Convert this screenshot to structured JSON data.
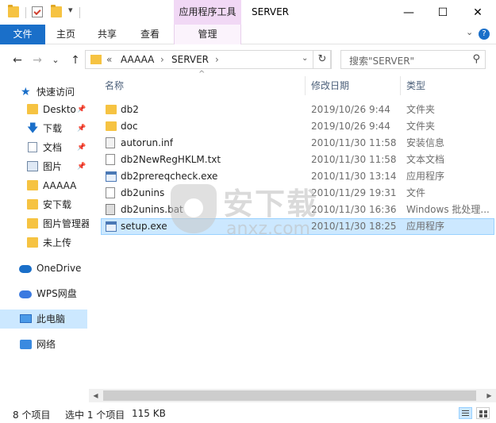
{
  "window": {
    "title": "SERVER",
    "contextual_tab_title": "应用程序工具",
    "controls": {
      "minimize": "—",
      "maximize": "☐",
      "close": "✕"
    }
  },
  "ribbon": {
    "tabs": [
      "文件",
      "主页",
      "共享",
      "查看",
      "管理"
    ],
    "expand_glyph": "⌄",
    "help_glyph": "?"
  },
  "address": {
    "back": "←",
    "forward": "→",
    "recent": "⌄",
    "up": "↑",
    "overflow": "«",
    "crumbs": [
      "AAAAA",
      "SERVER"
    ],
    "crumb_sep": "›",
    "dropdown": "⌄",
    "refresh": "↻",
    "search_placeholder": "搜索\"SERVER\"",
    "search_glyph": "⚲"
  },
  "nav": {
    "quick_access": "快速访问",
    "items": [
      {
        "label": "Deskto",
        "pinned": true
      },
      {
        "label": "下载",
        "pinned": true
      },
      {
        "label": "文档",
        "pinned": true
      },
      {
        "label": "图片",
        "pinned": true
      },
      {
        "label": "AAAAA",
        "pinned": false
      },
      {
        "label": "安下载",
        "pinned": false
      },
      {
        "label": "图片管理器",
        "pinned": false
      },
      {
        "label": "未上传",
        "pinned": false
      }
    ],
    "onedrive": "OneDrive",
    "wps": "WPS网盘",
    "this_pc": "此电脑",
    "network": "网络",
    "pin_glyph": "📌"
  },
  "columns": {
    "name": "名称",
    "date": "修改日期",
    "type": "类型",
    "sort_glyph": "^"
  },
  "files": [
    {
      "name": "db2",
      "date": "2019/10/26 9:44",
      "type": "文件夹",
      "icon": "folder"
    },
    {
      "name": "doc",
      "date": "2019/10/26 9:44",
      "type": "文件夹",
      "icon": "folder"
    },
    {
      "name": "autorun.inf",
      "date": "2010/11/30 11:58",
      "type": "安装信息",
      "icon": "inf"
    },
    {
      "name": "db2NewRegHKLM.txt",
      "date": "2010/11/30 11:58",
      "type": "文本文档",
      "icon": "doc"
    },
    {
      "name": "db2prereqcheck.exe",
      "date": "2010/11/30 13:14",
      "type": "应用程序",
      "icon": "exe"
    },
    {
      "name": "db2unins",
      "date": "2010/11/29 19:31",
      "type": "文件",
      "icon": "doc"
    },
    {
      "name": "db2unins.bat",
      "date": "2010/11/30 16:36",
      "type": "Windows 批处理...",
      "icon": "bat"
    },
    {
      "name": "setup.exe",
      "date": "2010/11/30 18:25",
      "type": "应用程序",
      "icon": "exe",
      "selected": true
    }
  ],
  "watermark": {
    "cn": "安下载",
    "en": "anxz.com"
  },
  "scroll": {
    "left": "◀",
    "right": "▶"
  },
  "status": {
    "count": "8 个项目",
    "selected": "选中 1 个项目",
    "size": "115 KB"
  }
}
